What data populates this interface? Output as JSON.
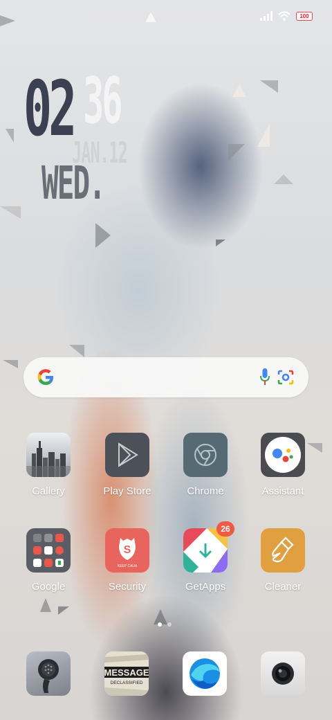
{
  "status_bar": {
    "battery_level": "100",
    "icons": [
      "signal-icon",
      "wifi-icon",
      "battery-icon"
    ]
  },
  "clock_widget": {
    "hour": "02",
    "minute": "36",
    "date": "JAN.12",
    "weekday": "WED."
  },
  "search_bar": {
    "icons": [
      "google-g-icon",
      "microphone-icon",
      "google-lens-icon"
    ]
  },
  "apps": [
    {
      "label": "Gallery",
      "icon": "gallery-icon"
    },
    {
      "label": "Play Store",
      "icon": "play-store-icon"
    },
    {
      "label": "Chrome",
      "icon": "chrome-icon"
    },
    {
      "label": "Assistant",
      "icon": "assistant-icon"
    },
    {
      "label": "Google",
      "icon": "google-folder-icon"
    },
    {
      "label": "Security",
      "icon": "security-icon",
      "icon_text": "KEEP CALM"
    },
    {
      "label": "GetApps",
      "icon": "getapps-icon",
      "badge": "26"
    },
    {
      "label": "Cleaner",
      "icon": "cleaner-icon"
    }
  ],
  "page_indicator": {
    "pages": 2,
    "current": 1
  },
  "dock": [
    {
      "icon": "phone-icon"
    },
    {
      "icon": "messages-icon",
      "text_top": "MESSAGE",
      "text_bottom": "DECLASSIFIED"
    },
    {
      "icon": "browser-icon"
    },
    {
      "icon": "camera-icon"
    }
  ],
  "colors": {
    "clock_hour": "#3b4150",
    "badge": "#ee5a44",
    "security_bg": "#e8645c",
    "cleaner_bg": "#e0a040",
    "play_store_bg": "#4b5059",
    "chrome_bg": "#556a73"
  }
}
